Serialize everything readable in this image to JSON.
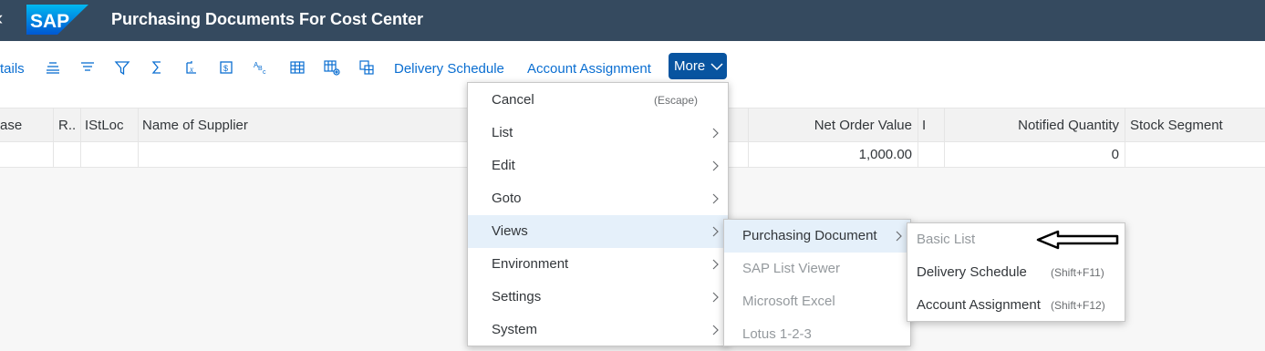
{
  "shell": {
    "title": "Purchasing Documents For Cost Center",
    "logo_text": "SAP",
    "back_icon": "chevron-left-icon"
  },
  "toolbar": {
    "details_label": "tails",
    "delivery_schedule_label": "Delivery Schedule",
    "account_assignment_label": "Account Assignment",
    "more_label": "More",
    "icons": [
      "align-center-icon",
      "align-left-icon",
      "filter-icon",
      "sum-icon",
      "subtotal-icon",
      "export-icon",
      "sort-abc-icon",
      "table-icon",
      "table-settings-icon",
      "layout-icon"
    ]
  },
  "table": {
    "headers": {
      "c0": "ase",
      "c1": "R..",
      "c2": "IStLoc",
      "c3": "Name of Supplier",
      "net_order_value": "Net Order Value",
      "i": "I",
      "notified_quantity": "Notified Quantity",
      "stock_segment": "Stock Segment"
    },
    "row": {
      "net_order_value": "1,000.00",
      "notified_quantity": "0"
    }
  },
  "menu": {
    "items": [
      {
        "label": "Cancel",
        "shortcut": "(Escape)"
      },
      {
        "label": "List"
      },
      {
        "label": "Edit"
      },
      {
        "label": "Goto"
      },
      {
        "label": "Views"
      },
      {
        "label": "Environment"
      },
      {
        "label": "Settings"
      },
      {
        "label": "System"
      }
    ]
  },
  "views_submenu": {
    "items": [
      {
        "label": "Purchasing Document"
      },
      {
        "label": "SAP List Viewer"
      },
      {
        "label": "Microsoft Excel"
      },
      {
        "label": "Lotus 1-2-3"
      }
    ]
  },
  "purchasing_submenu": {
    "items": [
      {
        "label": "Basic List"
      },
      {
        "label": "Delivery Schedule",
        "shortcut": "(Shift+F11)"
      },
      {
        "label": "Account Assignment",
        "shortcut": "(Shift+F12)"
      }
    ]
  },
  "colors": {
    "shell_bg": "#354a5f",
    "accent": "#0a6ed1",
    "more_bg": "#0854a0",
    "selected_bg": "#e5f0fa"
  }
}
